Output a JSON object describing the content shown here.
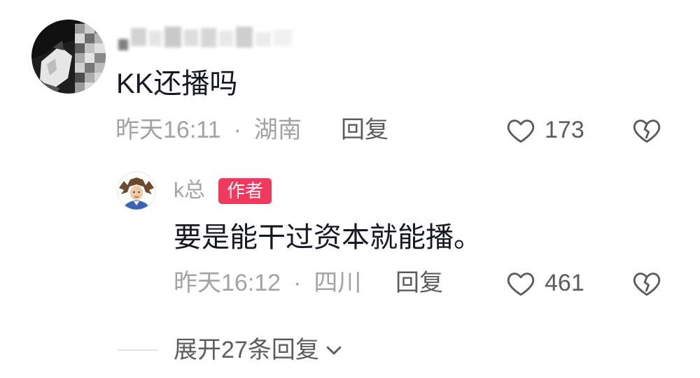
{
  "colors": {
    "background": "#ffffff",
    "text_primary": "#161823",
    "text_meta": "#a3a3a3",
    "text_secondary": "#5c5c5c",
    "badge_bg": "#f2385c",
    "badge_text": "#ffffff"
  },
  "comment": {
    "text": "KK还播吗",
    "time": "昨天16:11",
    "separator": "·",
    "location": "湖南",
    "reply_label": "回复",
    "like_count": "173",
    "like_icon": "heart-outline-icon",
    "dislike_icon": "broken-heart-icon"
  },
  "reply": {
    "author": "k总",
    "badge": "作者",
    "text": "要是能干过资本就能播。",
    "time": "昨天16:12",
    "separator": "·",
    "location": "四川",
    "reply_label": "回复",
    "like_count": "461",
    "like_icon": "heart-outline-icon",
    "dislike_icon": "broken-heart-icon"
  },
  "expand": {
    "label": "展开27条回复",
    "icon": "chevron-down-icon"
  }
}
